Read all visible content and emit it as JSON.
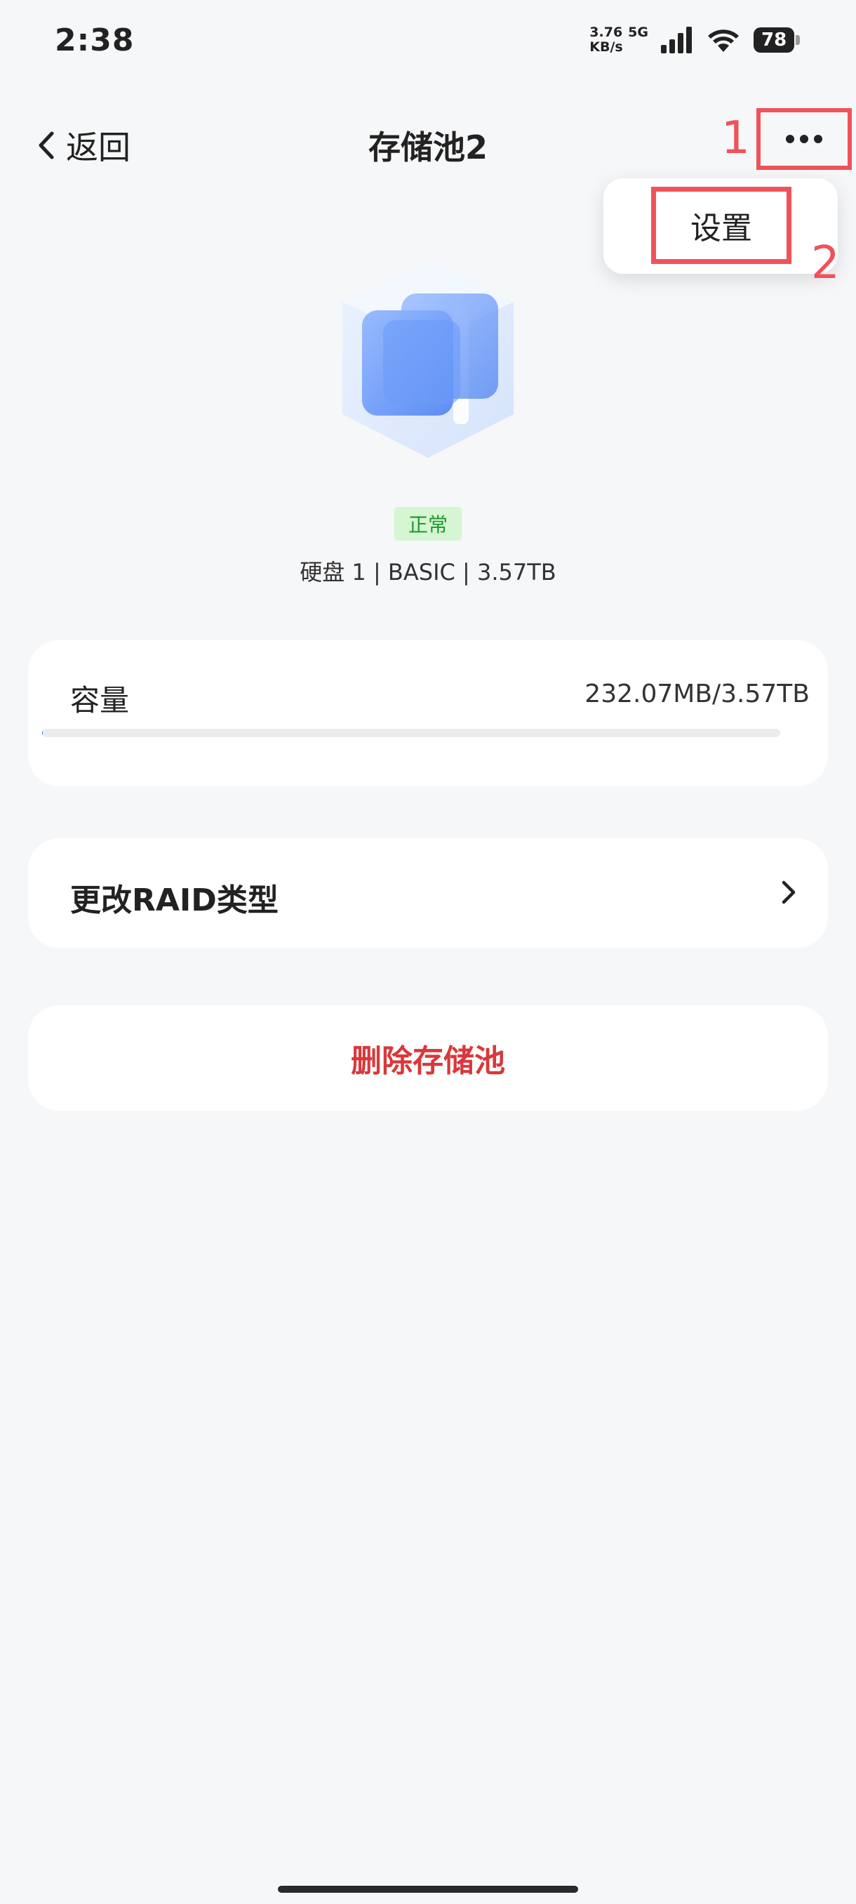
{
  "status_bar": {
    "time": "2:38",
    "net_speed_value": "3.76",
    "net_type": "5G",
    "net_speed_unit": "KB/s",
    "battery": "78"
  },
  "header": {
    "back_label": "返回",
    "title": "存储池2"
  },
  "annotations": {
    "first": "1",
    "second": "2"
  },
  "menu": {
    "settings_label": "设置"
  },
  "pool": {
    "status": "正常",
    "disk_info": "硬盘 1 | BASIC | 3.57TB"
  },
  "capacity": {
    "label": "容量",
    "value": "232.07MB/3.57TB",
    "used_fraction": 0.0001
  },
  "actions": {
    "change_raid_label": "更改RAID类型",
    "delete_label": "删除存储池"
  },
  "colors": {
    "annotation_red": "#f0525a",
    "delete_red": "#d9383b",
    "status_green": "#1a9a2d",
    "status_green_bg": "#d6f5d3",
    "icon_blue": "#5b8df5"
  }
}
